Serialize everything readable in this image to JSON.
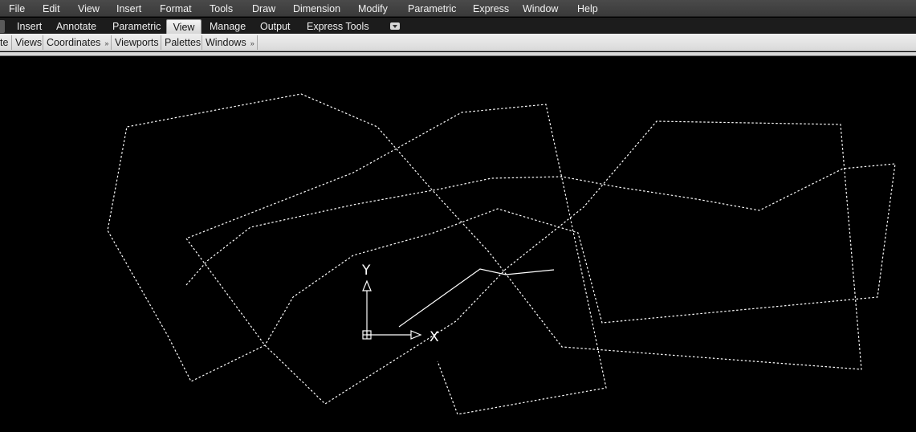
{
  "menubar": {
    "items": [
      "File",
      "Edit",
      "View",
      "Insert",
      "Format",
      "Tools",
      "Draw",
      "Dimension",
      "Modify",
      "Parametric",
      "Express",
      "Window",
      "Help"
    ]
  },
  "ribbon": {
    "tabs": [
      "Insert",
      "Annotate",
      "Parametric",
      "View",
      "Manage",
      "Output",
      "Express Tools"
    ],
    "active_tab": "View",
    "partial_left": ""
  },
  "panels": {
    "partial_first": "te",
    "items": [
      "Views",
      "Coordinates",
      "Viewports",
      "Palettes",
      "Windows"
    ],
    "expandable": [
      "Coordinates",
      "Windows"
    ]
  },
  "ucs": {
    "x_label": "X",
    "y_label": "Y"
  },
  "colors": {
    "menubar_bg": "#404040",
    "ribbon_tabs_bg": "#1c1c1c",
    "panel_bg": "#e4e4e4",
    "canvas_bg": "#000000",
    "geometry": "#ffffff"
  }
}
